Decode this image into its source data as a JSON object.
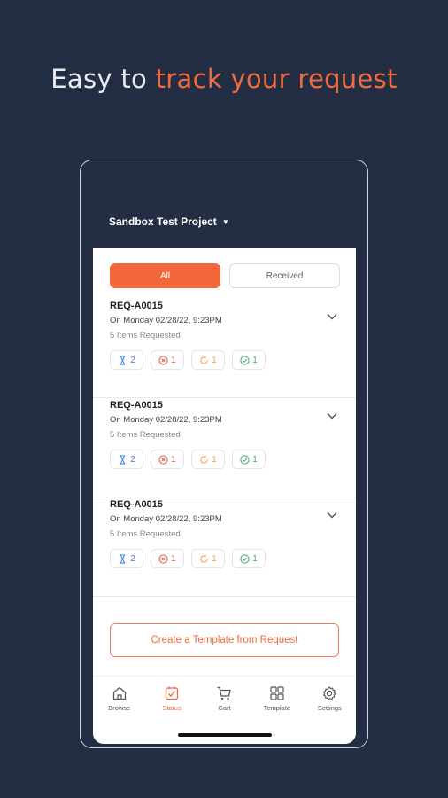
{
  "headline": {
    "prefix": "Easy to ",
    "accent": "track your request"
  },
  "project": {
    "name": "Sandbox Test Project"
  },
  "tabs": [
    {
      "label": "All",
      "active": true
    },
    {
      "label": "Received",
      "active": false
    }
  ],
  "requests": [
    {
      "id": "REQ-A0015",
      "date": "On Monday 02/28/22, 9:23PM",
      "items": "5 Items Requested",
      "badges": {
        "pending": "2",
        "rejected": "1",
        "processing": "1",
        "approved": "1"
      }
    },
    {
      "id": "REQ-A0015",
      "date": "On Monday 02/28/22, 9:23PM",
      "items": "5 Items Requested",
      "badges": {
        "pending": "2",
        "rejected": "1",
        "processing": "1",
        "approved": "1"
      }
    },
    {
      "id": "REQ-A0015",
      "date": "On Monday 02/28/22, 9:23PM",
      "items": "5 Items Requested",
      "badges": {
        "pending": "2",
        "rejected": "1",
        "processing": "1",
        "approved": "1"
      }
    }
  ],
  "create_button": "Create a Template from Request",
  "nav": [
    {
      "label": "Browse",
      "icon": "home-icon",
      "active": false
    },
    {
      "label": "Status",
      "icon": "status-icon",
      "active": true
    },
    {
      "label": "Cart",
      "icon": "cart-icon",
      "active": false
    },
    {
      "label": "Template",
      "icon": "grid-icon",
      "active": false
    },
    {
      "label": "Settings",
      "icon": "gear-icon",
      "active": false
    }
  ],
  "colors": {
    "background": "#232e45",
    "accent": "#f2683a"
  }
}
